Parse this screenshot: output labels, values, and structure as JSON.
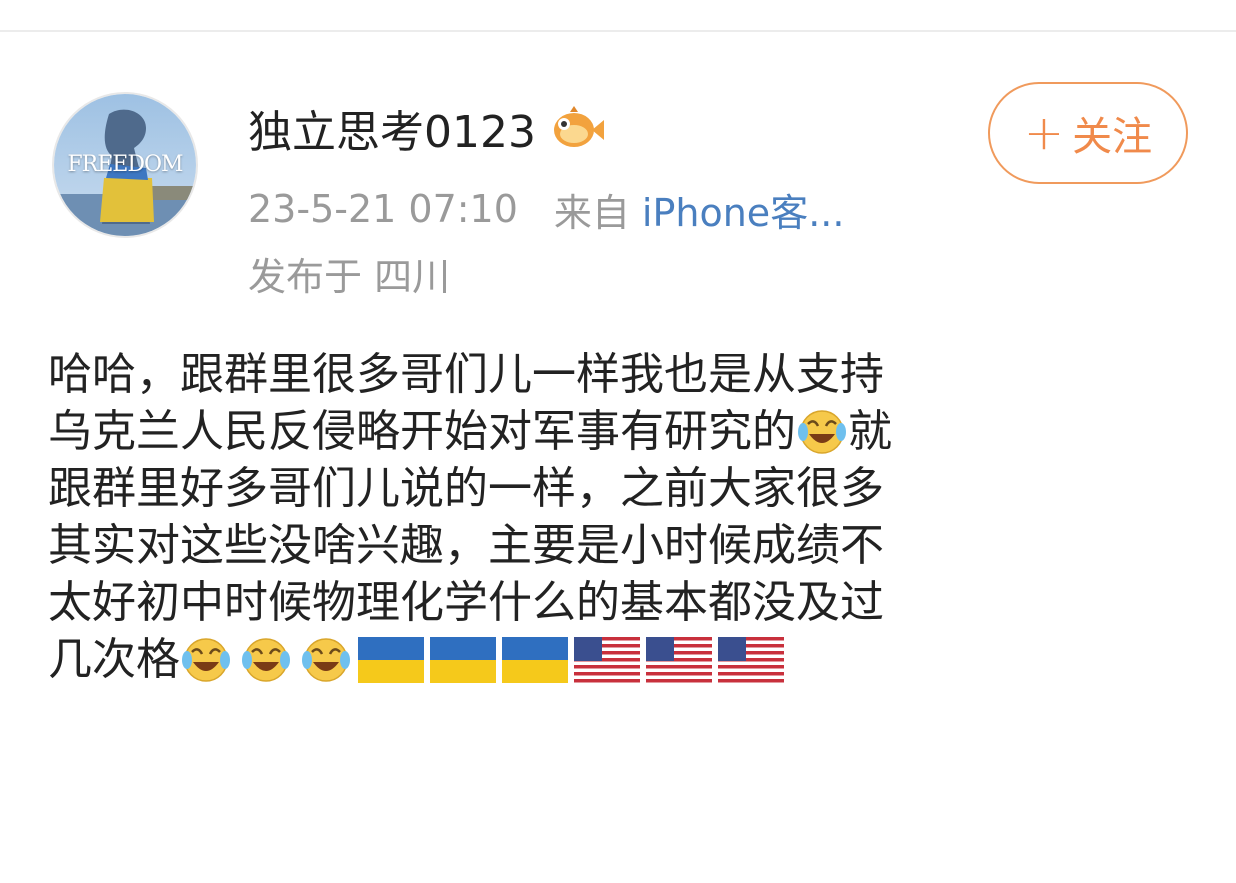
{
  "user": {
    "name": "独立思考0123",
    "avatar_text": "FREEDOM"
  },
  "follow_button": {
    "plus": "+",
    "label": "关注",
    "color": "#f08a4b"
  },
  "meta": {
    "timestamp": "23-5-21 07:10",
    "from_label": "来自",
    "source": "iPhone客...",
    "location": "发布于 四川"
  },
  "post": {
    "lines": [
      "哈哈，跟群里很多哥们儿一样我也是从支持",
      "乌克兰人民反侵略开始对军事有研究的",
      "跟群里好多哥们儿说的一样，之前大家很多",
      "其实对这些没啥兴趣，主要是小时候成绩不",
      "太好初中时候物理化学什么的基本都没及过",
      "几次格"
    ],
    "line2_tail": "就",
    "icons": [
      "laugh-cry-emoji",
      "ukraine-flag",
      "usa-flag",
      "badge-fish-icon"
    ]
  },
  "colors": {
    "text": "#222222",
    "meta_gray": "#9a9a9a",
    "link_blue": "#4a7fbf",
    "accent_orange": "#f08a4b"
  }
}
